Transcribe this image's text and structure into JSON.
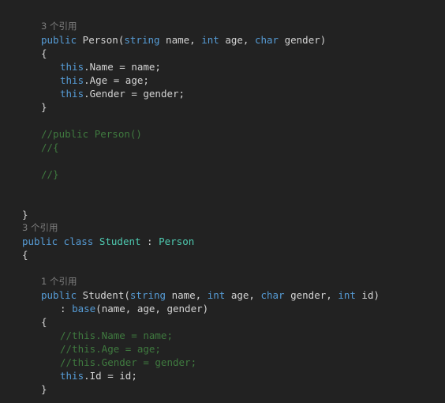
{
  "editor": {
    "language": "csharp",
    "theme": "dark",
    "background_color": "#222222",
    "default_text_color": "#d4d4d4",
    "keyword_color": "#569cd6",
    "type_color": "#4ec9b0",
    "comment_color": "#3f7a3f",
    "codelens_color": "#7d7d7d"
  },
  "lines": [
    {
      "id": "l1",
      "kind": "codelens",
      "indent": 1,
      "tokens": [
        {
          "t": "3 个引用",
          "c": "codelens"
        }
      ]
    },
    {
      "id": "l2",
      "kind": "code",
      "indent": 1,
      "tokens": [
        {
          "t": "public",
          "c": "kw"
        },
        {
          "t": " Person(",
          "c": "plain"
        },
        {
          "t": "string",
          "c": "kw"
        },
        {
          "t": " name, ",
          "c": "plain"
        },
        {
          "t": "int",
          "c": "kw"
        },
        {
          "t": " age, ",
          "c": "plain"
        },
        {
          "t": "char",
          "c": "kw"
        },
        {
          "t": " gender)",
          "c": "plain"
        }
      ]
    },
    {
      "id": "l3",
      "kind": "code",
      "indent": 1,
      "tokens": [
        {
          "t": "{",
          "c": "plain"
        }
      ]
    },
    {
      "id": "l4",
      "kind": "code",
      "indent": 2,
      "tokens": [
        {
          "t": "this",
          "c": "kw"
        },
        {
          "t": ".Name = name;",
          "c": "plain"
        }
      ]
    },
    {
      "id": "l5",
      "kind": "code",
      "indent": 2,
      "tokens": [
        {
          "t": "this",
          "c": "kw"
        },
        {
          "t": ".Age = age;",
          "c": "plain"
        }
      ]
    },
    {
      "id": "l6",
      "kind": "code",
      "indent": 2,
      "tokens": [
        {
          "t": "this",
          "c": "kw"
        },
        {
          "t": ".Gender = gender;",
          "c": "plain"
        }
      ]
    },
    {
      "id": "l7",
      "kind": "code",
      "indent": 1,
      "tokens": [
        {
          "t": "}",
          "c": "plain"
        }
      ]
    },
    {
      "id": "l8",
      "kind": "blank",
      "indent": 0,
      "tokens": []
    },
    {
      "id": "l9",
      "kind": "code",
      "indent": 1,
      "tokens": [
        {
          "t": "//public Person()",
          "c": "cmt"
        }
      ]
    },
    {
      "id": "l10",
      "kind": "code",
      "indent": 1,
      "tokens": [
        {
          "t": "//{",
          "c": "cmt"
        }
      ]
    },
    {
      "id": "l11",
      "kind": "blank",
      "indent": 0,
      "tokens": []
    },
    {
      "id": "l12",
      "kind": "code",
      "indent": 1,
      "tokens": [
        {
          "t": "//}",
          "c": "cmt"
        }
      ]
    },
    {
      "id": "l13",
      "kind": "blank",
      "indent": 0,
      "tokens": []
    },
    {
      "id": "l14",
      "kind": "blank",
      "indent": 0,
      "tokens": []
    },
    {
      "id": "l15",
      "kind": "code",
      "indent": 0,
      "tokens": [
        {
          "t": "}",
          "c": "plain"
        }
      ]
    },
    {
      "id": "l16",
      "kind": "codelens",
      "indent": 0,
      "tokens": [
        {
          "t": "3 个引用",
          "c": "codelens"
        }
      ]
    },
    {
      "id": "l17",
      "kind": "code",
      "indent": 0,
      "tokens": [
        {
          "t": "public class",
          "c": "kw"
        },
        {
          "t": " ",
          "c": "plain"
        },
        {
          "t": "Student",
          "c": "type"
        },
        {
          "t": " : ",
          "c": "plain"
        },
        {
          "t": "Person",
          "c": "type"
        }
      ]
    },
    {
      "id": "l18",
      "kind": "code",
      "indent": 0,
      "tokens": [
        {
          "t": "{",
          "c": "plain"
        }
      ]
    },
    {
      "id": "l19",
      "kind": "blank",
      "indent": 0,
      "tokens": []
    },
    {
      "id": "l20",
      "kind": "codelens",
      "indent": 1,
      "tokens": [
        {
          "t": "1 个引用",
          "c": "codelens"
        }
      ]
    },
    {
      "id": "l21",
      "kind": "code",
      "indent": 1,
      "tokens": [
        {
          "t": "public",
          "c": "kw"
        },
        {
          "t": " Student(",
          "c": "plain"
        },
        {
          "t": "string",
          "c": "kw"
        },
        {
          "t": " name, ",
          "c": "plain"
        },
        {
          "t": "int",
          "c": "kw"
        },
        {
          "t": " age, ",
          "c": "plain"
        },
        {
          "t": "char",
          "c": "kw"
        },
        {
          "t": " gender, ",
          "c": "plain"
        },
        {
          "t": "int",
          "c": "kw"
        },
        {
          "t": " id)",
          "c": "plain"
        }
      ]
    },
    {
      "id": "l22",
      "kind": "code",
      "indent": 2,
      "tokens": [
        {
          "t": ": ",
          "c": "plain"
        },
        {
          "t": "base",
          "c": "kw"
        },
        {
          "t": "(name, age, gender)",
          "c": "plain"
        }
      ]
    },
    {
      "id": "l23",
      "kind": "code",
      "indent": 1,
      "tokens": [
        {
          "t": "{",
          "c": "plain"
        }
      ]
    },
    {
      "id": "l24",
      "kind": "code",
      "indent": 2,
      "tokens": [
        {
          "t": "//this.Name = name;",
          "c": "cmt"
        }
      ]
    },
    {
      "id": "l25",
      "kind": "code",
      "indent": 2,
      "tokens": [
        {
          "t": "//this.Age = age;",
          "c": "cmt"
        }
      ]
    },
    {
      "id": "l26",
      "kind": "code",
      "indent": 2,
      "tokens": [
        {
          "t": "//this.Gender = gender;",
          "c": "cmt"
        }
      ]
    },
    {
      "id": "l27",
      "kind": "code",
      "indent": 2,
      "tokens": [
        {
          "t": "this",
          "c": "kw"
        },
        {
          "t": ".Id = id;",
          "c": "plain"
        }
      ]
    },
    {
      "id": "l28",
      "kind": "code",
      "indent": 1,
      "tokens": [
        {
          "t": "}",
          "c": "plain"
        }
      ]
    }
  ]
}
